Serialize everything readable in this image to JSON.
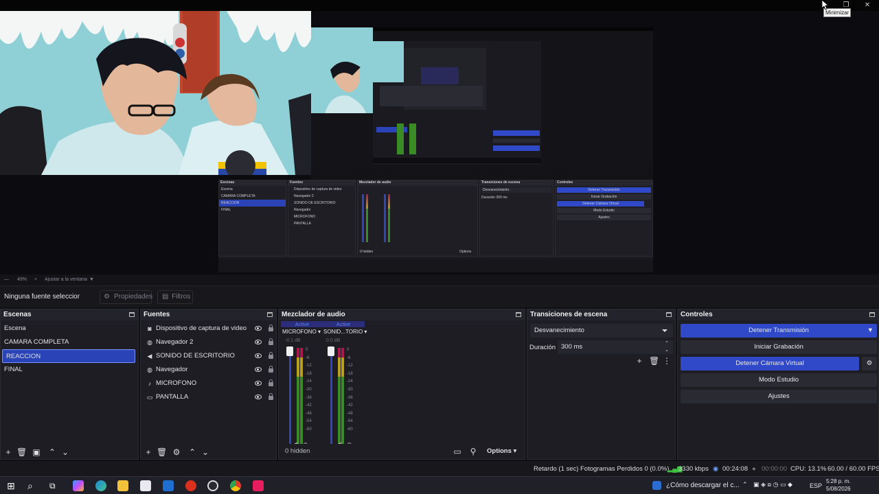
{
  "window": {
    "tooltip": "Minimizar"
  },
  "preview": {
    "zoom": "49%",
    "fit_label": "Ajustar a la ventana",
    "nested_docks": {
      "scenes": "Escenas",
      "sources": "Fuentes",
      "mixer": "Mezclador de audio",
      "transitions": "Transiciones de escena",
      "controls": "Controles",
      "scene_items": [
        "Escena",
        "CAMARA COMPLETA",
        "REACCION",
        "FINAL"
      ],
      "source_items": [
        "Dispositivo de captura de video",
        "Navegador 2",
        "SONIDO DE ESCRITORIO",
        "Navegador",
        "MICROFONO",
        "PANTALLA"
      ],
      "ctrl_items": [
        "Detener Transmisión",
        "Iniciar Grabación",
        "Detener Cámara Virtual",
        "Modo Estudio",
        "Ajustes"
      ],
      "trans_combo": "Desvanecimiento",
      "trans_duration": "Duración",
      "trans_value": "300 ms",
      "hidden": "0 hidden",
      "options": "Options"
    }
  },
  "context": {
    "no_source": "Ninguna fuente seleccionada",
    "properties": "Propiedades",
    "filters": "Filtros"
  },
  "scenes": {
    "title": "Escenas",
    "items": [
      "Escena",
      "CAMARA COMPLETA",
      "REACCION",
      "FINAL"
    ],
    "selected": "REACCION"
  },
  "sources": {
    "title": "Fuentes",
    "items": [
      {
        "icon": "camera-icon",
        "label": "Dispositivo de captura de video"
      },
      {
        "icon": "globe-icon",
        "label": "Navegador 2"
      },
      {
        "icon": "speaker-icon",
        "label": "SONIDO DE ESCRITORIO"
      },
      {
        "icon": "globe-icon",
        "label": "Navegador"
      },
      {
        "icon": "microphone-icon",
        "label": "MICROFONO"
      },
      {
        "icon": "monitor-icon",
        "label": "PANTALLA"
      }
    ]
  },
  "mixer": {
    "title": "Mezclador de audio",
    "channels": [
      {
        "active": "Active",
        "name": "MICROFONO",
        "db": "-0.1 dB"
      },
      {
        "active": "Active",
        "name": "SONID...TORIO",
        "db": "0.0 dB"
      }
    ],
    "ticks": [
      "0",
      "-6",
      "-12",
      "-18",
      "-24",
      "-30",
      "-36",
      "-42",
      "-48",
      "-54",
      "-60"
    ],
    "hidden": "0 hidden",
    "options": "Options"
  },
  "transitions": {
    "title": "Transiciones de escena",
    "type": "Desvanecimiento",
    "duration_label": "Duración",
    "duration_value": "300 ms"
  },
  "controls": {
    "title": "Controles",
    "stop_stream": "Detener Transmisión",
    "start_recording": "Iniciar Grabación",
    "stop_virtual_cam": "Detener Cámara Virtual",
    "studio_mode": "Modo Estudio",
    "settings": "Ajustes"
  },
  "status": {
    "delay": "Retardo (1 sec)",
    "dropped": "Fotogramas Perdidos 0 (0.0%)",
    "bitrate": "3330 kbps",
    "stream_time": "00:24:08",
    "rec_time": "00:00:00",
    "cpu": "CPU: 13.1%",
    "fps": "60.00 / 60.00 FPS"
  },
  "taskbar": {
    "news": "¿Cómo descargar el c...",
    "lang": "ESP",
    "time": "5:28 p. m.",
    "date": "5/08/2026"
  },
  "colors": {
    "accent": "#2f49c8",
    "selected": "#2a43b6",
    "active_text": "#4d8cff"
  }
}
